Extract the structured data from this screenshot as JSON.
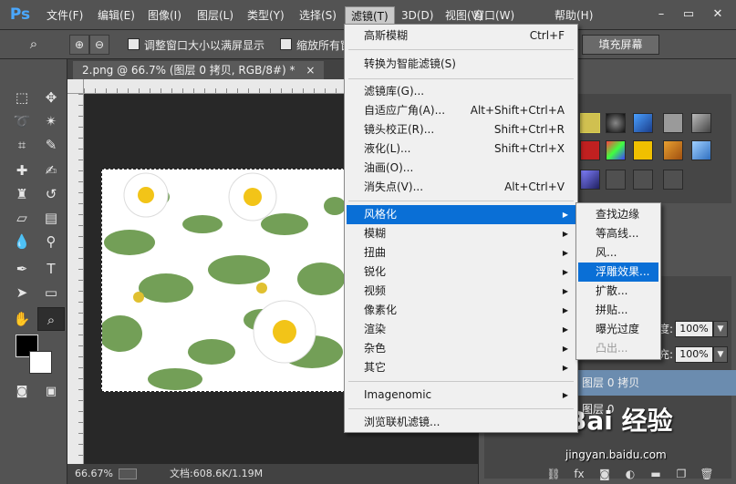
{
  "app": {
    "logo": "Ps"
  },
  "menubar": {
    "items": [
      "文件(F)",
      "编辑(E)",
      "图像(I)",
      "图层(L)",
      "类型(Y)",
      "选择(S)",
      "滤镜(T)",
      "3D(D)",
      "视图(V)",
      "窗口(W)",
      "帮助(H)"
    ],
    "active_index": 6,
    "win_minimize": "–",
    "win_restore": "▭",
    "win_close": "✕"
  },
  "options": {
    "resize_windows_label": "调整窗口大小以满屏显示",
    "zoom_all_label": "缩放所有窗",
    "fill_screen_label": "填充屏幕"
  },
  "document": {
    "tab_title": "2.png @ 66.7% (图层 0 拷贝, RGB/8#) *",
    "tab_close": "×",
    "zoom": "66.67%",
    "doc_info": "文档:608.6K/1.19M"
  },
  "filter_menu": {
    "items": [
      {
        "label": "高斯模糊",
        "shortcut": "Ctrl+F",
        "arrow": false,
        "highlight": false
      },
      {
        "label": "转换为智能滤镜(S)",
        "shortcut": "",
        "arrow": false,
        "highlight": false
      },
      {
        "label": "滤镜库(G)...",
        "shortcut": "",
        "arrow": false,
        "highlight": false
      },
      {
        "label": "自适应广角(A)...",
        "shortcut": "Alt+Shift+Ctrl+A",
        "arrow": false,
        "highlight": false
      },
      {
        "label": "镜头校正(R)...",
        "shortcut": "Shift+Ctrl+R",
        "arrow": false,
        "highlight": false
      },
      {
        "label": "液化(L)...",
        "shortcut": "Shift+Ctrl+X",
        "arrow": false,
        "highlight": false
      },
      {
        "label": "油画(O)...",
        "shortcut": "",
        "arrow": false,
        "highlight": false
      },
      {
        "label": "消失点(V)...",
        "shortcut": "Alt+Ctrl+V",
        "arrow": false,
        "highlight": false
      },
      {
        "label": "风格化",
        "shortcut": "",
        "arrow": true,
        "highlight": true
      },
      {
        "label": "模糊",
        "shortcut": "",
        "arrow": true,
        "highlight": false
      },
      {
        "label": "扭曲",
        "shortcut": "",
        "arrow": true,
        "highlight": false
      },
      {
        "label": "锐化",
        "shortcut": "",
        "arrow": true,
        "highlight": false
      },
      {
        "label": "视频",
        "shortcut": "",
        "arrow": true,
        "highlight": false
      },
      {
        "label": "像素化",
        "shortcut": "",
        "arrow": true,
        "highlight": false
      },
      {
        "label": "渲染",
        "shortcut": "",
        "arrow": true,
        "highlight": false
      },
      {
        "label": "杂色",
        "shortcut": "",
        "arrow": true,
        "highlight": false
      },
      {
        "label": "其它",
        "shortcut": "",
        "arrow": true,
        "highlight": false
      },
      {
        "label": "Imagenomic",
        "shortcut": "",
        "arrow": true,
        "highlight": false
      },
      {
        "label": "浏览联机滤镜...",
        "shortcut": "",
        "arrow": false,
        "highlight": false
      }
    ]
  },
  "stylize_submenu": {
    "items": [
      {
        "label": "查找边缘",
        "highlight": false,
        "disabled": false
      },
      {
        "label": "等高线...",
        "highlight": false,
        "disabled": false
      },
      {
        "label": "风...",
        "highlight": false,
        "disabled": false
      },
      {
        "label": "浮雕效果...",
        "highlight": true,
        "disabled": false
      },
      {
        "label": "扩散...",
        "highlight": false,
        "disabled": false
      },
      {
        "label": "拼贴...",
        "highlight": false,
        "disabled": false
      },
      {
        "label": "曝光过度",
        "highlight": false,
        "disabled": false
      },
      {
        "label": "凸出...",
        "highlight": false,
        "disabled": true
      }
    ]
  },
  "layers": {
    "opacity_label": "度:",
    "opacity_value": "100%",
    "fill_label": "充:",
    "fill_value": "100%",
    "rows": [
      {
        "name": "图层 0 拷贝",
        "selected": true
      },
      {
        "name": "图层 0",
        "selected": false
      }
    ]
  },
  "watermark": {
    "brand": "Bai  经验",
    "url": "jingyan.baidu.com"
  },
  "colors": {
    "highlight": "#0a6fd6",
    "layer_selected": "#6b8caf",
    "panel": "#535353"
  }
}
